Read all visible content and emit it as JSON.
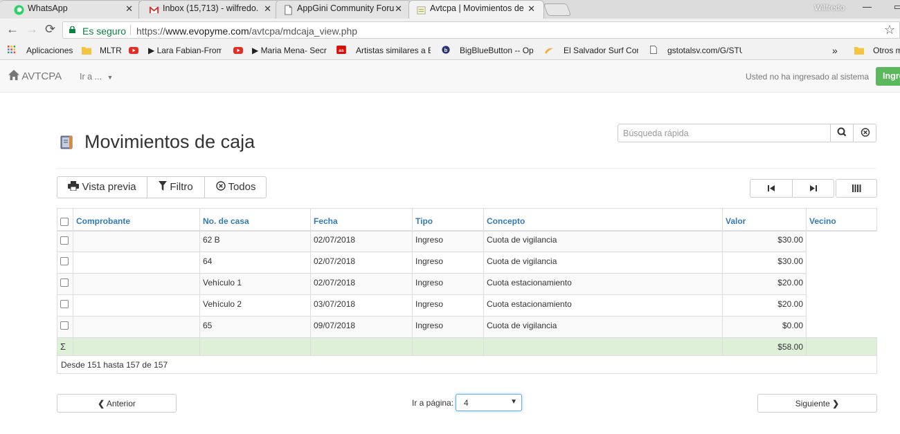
{
  "browser": {
    "tabs": [
      {
        "title": "WhatsApp",
        "icon": "whatsapp-icon"
      },
      {
        "title": "Inbox (15,713) - wilfredo.",
        "icon": "gmail-icon"
      },
      {
        "title": "AppGini Community Foru",
        "icon": "page-icon"
      },
      {
        "title": "Avtcpa | Movimientos de",
        "icon": "note-icon",
        "active": true
      }
    ],
    "user": "Wilfredo",
    "secure_label": "Es seguro",
    "url_prefix": "https://",
    "url_host": "www.evopyme.com",
    "url_path": "/avtcpa/mdcaja_view.php",
    "bookmarks": [
      {
        "label": "Aplicaciones",
        "icon": "apps-grid-icon"
      },
      {
        "label": "MLTR",
        "icon": "folder-icon"
      },
      {
        "label": "▶ Lara Fabian-From",
        "icon": "youtube-icon"
      },
      {
        "label": "▶ Maria Mena- Secr",
        "icon": "youtube-icon"
      },
      {
        "label": "Artistas similares a E",
        "icon": "lastfm-icon"
      },
      {
        "label": "BigBlueButton -- Op",
        "icon": "bigbluebutton-icon"
      },
      {
        "label": "El Salvador Surf Com",
        "icon": "surf-icon"
      },
      {
        "label": "gstotalsv.com/G/STU",
        "icon": "page-icon"
      }
    ],
    "more_bookmarks": "»",
    "other_bookmarks": "Otros m"
  },
  "navbar": {
    "brand": "AVTCPA",
    "goto_menu": "Ir a ...",
    "not_logged": "Usted no ha ingresado al sistema",
    "login_button": "Ingre"
  },
  "page": {
    "title": "Movimientos de caja",
    "search_placeholder": "Búsqueda rápida",
    "buttons": {
      "preview": "Vista previa",
      "filter": "Filtro",
      "all": "Todos"
    }
  },
  "table": {
    "columns": [
      "Comprobante",
      "No. de casa",
      "Fecha",
      "Tipo",
      "Concepto",
      "Valor",
      "Vecino"
    ],
    "rows": [
      {
        "comprobante": "",
        "casa": "62 B",
        "fecha": "02/07/2018",
        "tipo": "Ingreso",
        "concepto": "Cuota de vigilancia",
        "valor": "$30.00",
        "vecino": ""
      },
      {
        "comprobante": "",
        "casa": "64",
        "fecha": "02/07/2018",
        "tipo": "Ingreso",
        "concepto": "Cuota de vigilancia",
        "valor": "$30.00",
        "vecino": ""
      },
      {
        "comprobante": "",
        "casa": "Vehículo 1",
        "fecha": "02/07/2018",
        "tipo": "Ingreso",
        "concepto": "Cuota estacionamiento",
        "valor": "$20.00",
        "vecino": ""
      },
      {
        "comprobante": "",
        "casa": "Vehículo 2",
        "fecha": "03/07/2018",
        "tipo": "Ingreso",
        "concepto": "Cuota estacionamiento",
        "valor": "$20.00",
        "vecino": ""
      },
      {
        "comprobante": "",
        "casa": "65",
        "fecha": "09/07/2018",
        "tipo": "Ingreso",
        "concepto": "Cuota de vigilancia",
        "valor": "$0.00",
        "vecino": ""
      }
    ],
    "sum_symbol": "Σ",
    "sum_value": "$58.00",
    "record_info": "Desde 151 hasta 157 de 157"
  },
  "pagination": {
    "prev": "Anterior",
    "goto_label": "Ir a página:",
    "current_page": "4",
    "next": "Siguiente"
  }
}
